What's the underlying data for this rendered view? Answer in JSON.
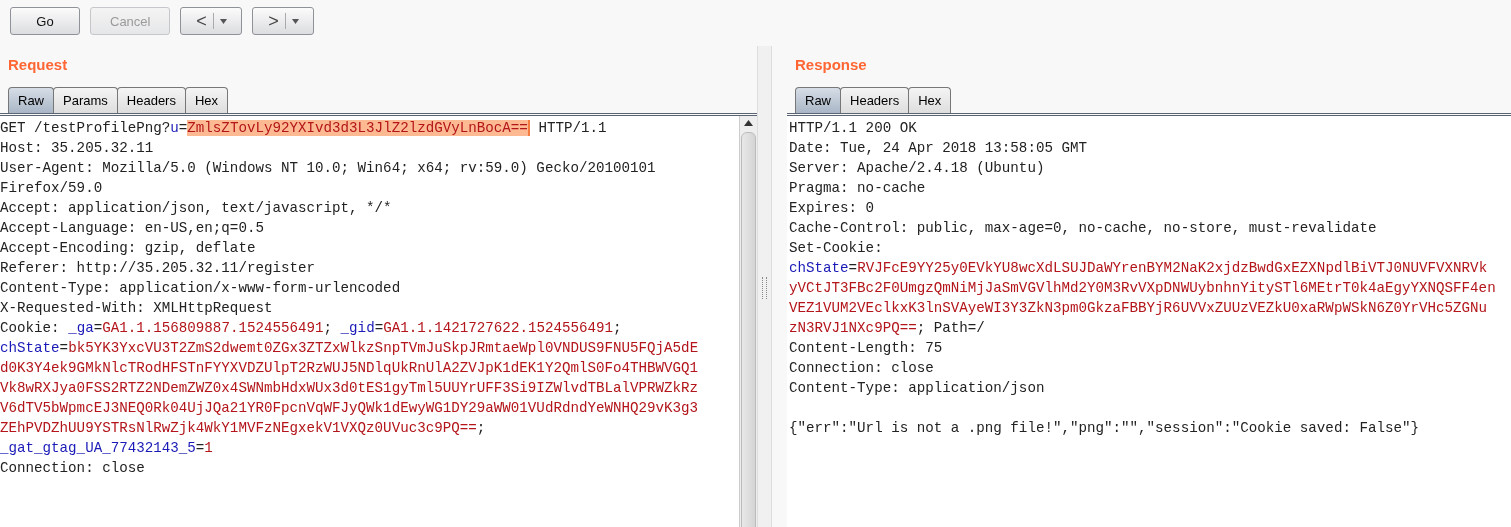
{
  "toolbar": {
    "buttons": [
      {
        "kind": "text",
        "label": "Go",
        "disabled": false
      },
      {
        "kind": "text",
        "label": "Cancel",
        "disabled": true
      },
      {
        "kind": "nav",
        "label": "<",
        "disabled": false
      },
      {
        "kind": "nav",
        "label": ">",
        "disabled": false
      }
    ]
  },
  "request": {
    "title": "Request",
    "tabs": [
      {
        "label": "Raw",
        "selected": true
      },
      {
        "label": "Params",
        "selected": false
      },
      {
        "label": "Headers",
        "selected": false
      },
      {
        "label": "Hex",
        "selected": false
      }
    ],
    "lines": [
      [
        {
          "kind": "plain",
          "text": "GET /testProfilePng?"
        },
        {
          "kind": "name",
          "text": "u"
        },
        {
          "kind": "plain",
          "text": "="
        },
        {
          "kind": "highlight",
          "text": "ZmlsZTovLy92YXIvd3d3L3JlZ2lzdGVyLnBocA=="
        },
        {
          "kind": "plain",
          "text": " HTTP/1.1"
        }
      ],
      [
        {
          "kind": "plain",
          "text": "Host: 35.205.32.11"
        }
      ],
      [
        {
          "kind": "plain",
          "text": "User-Agent: Mozilla/5.0 (Windows NT 10.0; Win64; x64; rv:59.0) Gecko/20100101"
        }
      ],
      [
        {
          "kind": "plain",
          "text": "Firefox/59.0"
        }
      ],
      [
        {
          "kind": "plain",
          "text": "Accept: application/json, text/javascript, */*"
        }
      ],
      [
        {
          "kind": "plain",
          "text": "Accept-Language: en-US,en;q=0.5"
        }
      ],
      [
        {
          "kind": "plain",
          "text": "Accept-Encoding: gzip, deflate"
        }
      ],
      [
        {
          "kind": "plain",
          "text": "Referer: http://35.205.32.11/register"
        }
      ],
      [
        {
          "kind": "plain",
          "text": "Content-Type: application/x-www-form-urlencoded"
        }
      ],
      [
        {
          "kind": "plain",
          "text": "X-Requested-With: XMLHttpRequest"
        }
      ],
      [
        {
          "kind": "plain",
          "text": "Cookie: "
        },
        {
          "kind": "name",
          "text": "_ga"
        },
        {
          "kind": "plain",
          "text": "="
        },
        {
          "kind": "value",
          "text": "GA1.1.156809887.1524556491"
        },
        {
          "kind": "plain",
          "text": "; "
        },
        {
          "kind": "name",
          "text": "_gid"
        },
        {
          "kind": "plain",
          "text": "="
        },
        {
          "kind": "value",
          "text": "GA1.1.1421727622.1524556491"
        },
        {
          "kind": "plain",
          "text": ";"
        }
      ],
      [
        {
          "kind": "name",
          "text": "chState"
        },
        {
          "kind": "plain",
          "text": "="
        },
        {
          "kind": "value",
          "text": "bk5YK3YxcVU3T2ZmS2dwemt0ZGx3ZTZxWlkzSnpTVmJuSkpJRmtaeWpl0VNDUS9FNU5FQjA5dE"
        }
      ],
      [
        {
          "kind": "value",
          "text": "d0K3Y4ek9GMkNlcTRodHFSTnFYYXVDZUlpT2RzWUJ5NDlqUkRnUlA2ZVJpK1dEK1Y2QmlS0Fo4THBWVGQ1"
        }
      ],
      [
        {
          "kind": "value",
          "text": "Vk8wRXJya0FSS2RTZ2NDemZWZ0x4SWNmbHdxWUx3d0tES1gyTml5UUYrUFF3Si9IZWlvdTBLalVPRWZkRz"
        }
      ],
      [
        {
          "kind": "value",
          "text": "V6dTV5bWpmcEJ3NEQ0Rk04UjJQa21YR0FpcnVqWFJyQWk1dEwyWG1DY29aWW01VUdRdndYeWNHQ29vK3g3"
        }
      ],
      [
        {
          "kind": "value",
          "text": "ZEhPVDZhUU9YSTRsNlRwZjk4WkY1MVFzNEgxekV1VXQz0UVuc3c9PQ=="
        },
        {
          "kind": "plain",
          "text": ";"
        }
      ],
      [
        {
          "kind": "name",
          "text": "_gat_gtag_UA_77432143_5"
        },
        {
          "kind": "plain",
          "text": "="
        },
        {
          "kind": "value",
          "text": "1"
        }
      ],
      [
        {
          "kind": "plain",
          "text": "Connection: close"
        }
      ]
    ]
  },
  "response": {
    "title": "Response",
    "tabs": [
      {
        "label": "Raw",
        "selected": true
      },
      {
        "label": "Headers",
        "selected": false
      },
      {
        "label": "Hex",
        "selected": false
      }
    ],
    "lines": [
      [
        {
          "kind": "plain",
          "text": "HTTP/1.1 200 OK"
        }
      ],
      [
        {
          "kind": "plain",
          "text": "Date: Tue, 24 Apr 2018 13:58:05 GMT"
        }
      ],
      [
        {
          "kind": "plain",
          "text": "Server: Apache/2.4.18 (Ubuntu)"
        }
      ],
      [
        {
          "kind": "plain",
          "text": "Pragma: no-cache"
        }
      ],
      [
        {
          "kind": "plain",
          "text": "Expires: 0"
        }
      ],
      [
        {
          "kind": "plain",
          "text": "Cache-Control: public, max-age=0, no-cache, no-store, must-revalidate"
        }
      ],
      [
        {
          "kind": "plain",
          "text": "Set-Cookie:"
        }
      ],
      [
        {
          "kind": "name",
          "text": "chState"
        },
        {
          "kind": "plain",
          "text": "="
        },
        {
          "kind": "value",
          "text": "RVJFcE9YY25y0EVkYU8wcXdLSUJDaWYrenBYM2NaK2xjdzBwdGxEZXNpdlBiVTJ0NUVFVXNRVk"
        }
      ],
      [
        {
          "kind": "value",
          "text": "yVCtJT3FBc2F0UmgzQmNiMjJaSmVGVlhMd2Y0M3RvVXpDNWUybnhnYitySTl6MEtrT0k4aEgyYXNQSFF4en"
        }
      ],
      [
        {
          "kind": "value",
          "text": "VEZ1VUM2VEclkxK3lnSVAyeWI3Y3ZkN3pm0GkzaFBBYjR6UVVxZUUzVEZkU0xaRWpWSkN6Z0YrVHc5ZGNu"
        }
      ],
      [
        {
          "kind": "value",
          "text": "zN3RVJ1NXc9PQ=="
        },
        {
          "kind": "plain",
          "text": "; Path=/"
        }
      ],
      [
        {
          "kind": "plain",
          "text": "Content-Length: 75"
        }
      ],
      [
        {
          "kind": "plain",
          "text": "Connection: close"
        }
      ],
      [
        {
          "kind": "plain",
          "text": "Content-Type: application/json"
        }
      ],
      [
        {
          "kind": "blank"
        }
      ],
      [
        {
          "kind": "plain",
          "text": "{\"err\":\"Url is not a .png file!\",\"png\":\"\",\"session\":\"Cookie saved: False\"}"
        }
      ]
    ]
  }
}
